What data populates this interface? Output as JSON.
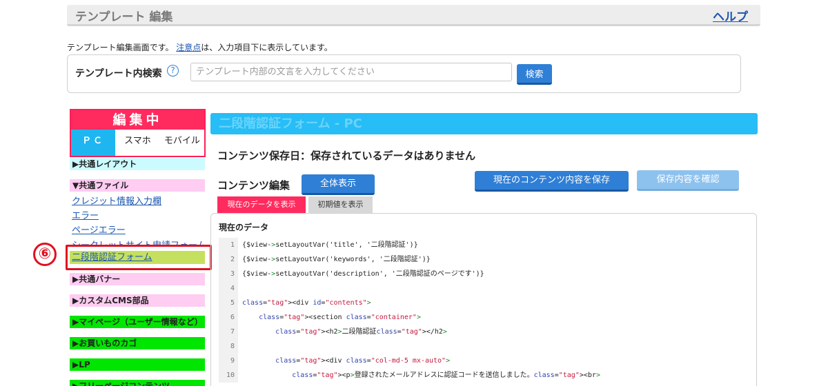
{
  "page": {
    "title": "テンプレート 編集",
    "help_label": "ヘルプ",
    "intro_before": "テンプレート編集画面です。",
    "intro_link": "注意点",
    "intro_after": "は、入力項目下に表示しています。"
  },
  "search": {
    "label": "テンプレート内検索",
    "help_icon": "?",
    "placeholder": "テンプレート内部の文言を入力してください",
    "value": "",
    "button_label": "検索"
  },
  "sidebar": {
    "editing_label": "編集中",
    "device_tabs": [
      {
        "label": "ＰＣ",
        "active": true
      },
      {
        "label": "スマホ",
        "active": false
      },
      {
        "label": "モバイル",
        "active": false
      }
    ],
    "groups": {
      "common_layout": "▶共通レイアウト",
      "common_files": "▼共通ファイル",
      "common_banner": "▶共通バナー",
      "custom_cms": "▶カスタムCMS部品",
      "mypage": "▶マイページ（ユーザー情報など）",
      "cart": "▶お買いものカゴ",
      "lp": "▶LP",
      "free_page": "▶フリーページコンテンツ"
    },
    "files": [
      "クレジット情報入力欄",
      "エラー",
      "ページエラー",
      "シークレットサイト申請フォーム",
      "二段階認証フォーム"
    ],
    "annotation": "⑥",
    "colors": {
      "layout_group": "#ccfbff",
      "files_group": "#ffccf2",
      "green_group": "#00e600",
      "current_item": "#c5e05f",
      "editing_accent": "#ff2b5e",
      "active_tab": "#1eb6f0"
    }
  },
  "main": {
    "header_title": "二段階認証フォーム - PC",
    "saved_date": "コンテンツ保存日：保存されているデータはありません",
    "edit_heading": "コンテンツ編集",
    "show_all_button": "全体表示",
    "save_button": "現在のコンテンツ内容を保存",
    "confirm_button": "保存内容を確認",
    "tab_current": "現在のデータを表示",
    "tab_initial": "初期値を表示",
    "code_caption": "現在のデータ",
    "code_lines": [
      {
        "n": "1",
        "text": "{$view->setLayoutVar('title', '二段階認証')}"
      },
      {
        "n": "2",
        "text": "{$view->setLayoutVar('keywords', '二段階認証')}"
      },
      {
        "n": "3",
        "text": "{$view->setLayoutVar('description', '二段階認証のページです')}"
      },
      {
        "n": "4",
        "text": ""
      },
      {
        "n": "5",
        "text": "<div id=\"contents\">"
      },
      {
        "n": "6",
        "text": "    <section class=\"container\">"
      },
      {
        "n": "7",
        "text": "        <h2>二段階認証</h2>"
      },
      {
        "n": "8",
        "text": ""
      },
      {
        "n": "9",
        "text": "        <div class=\"col-md-5 mx-auto\">"
      },
      {
        "n": "10",
        "text": "            <p>登録されたメールアドレスに認証コードを送信しました。<br>"
      }
    ]
  }
}
